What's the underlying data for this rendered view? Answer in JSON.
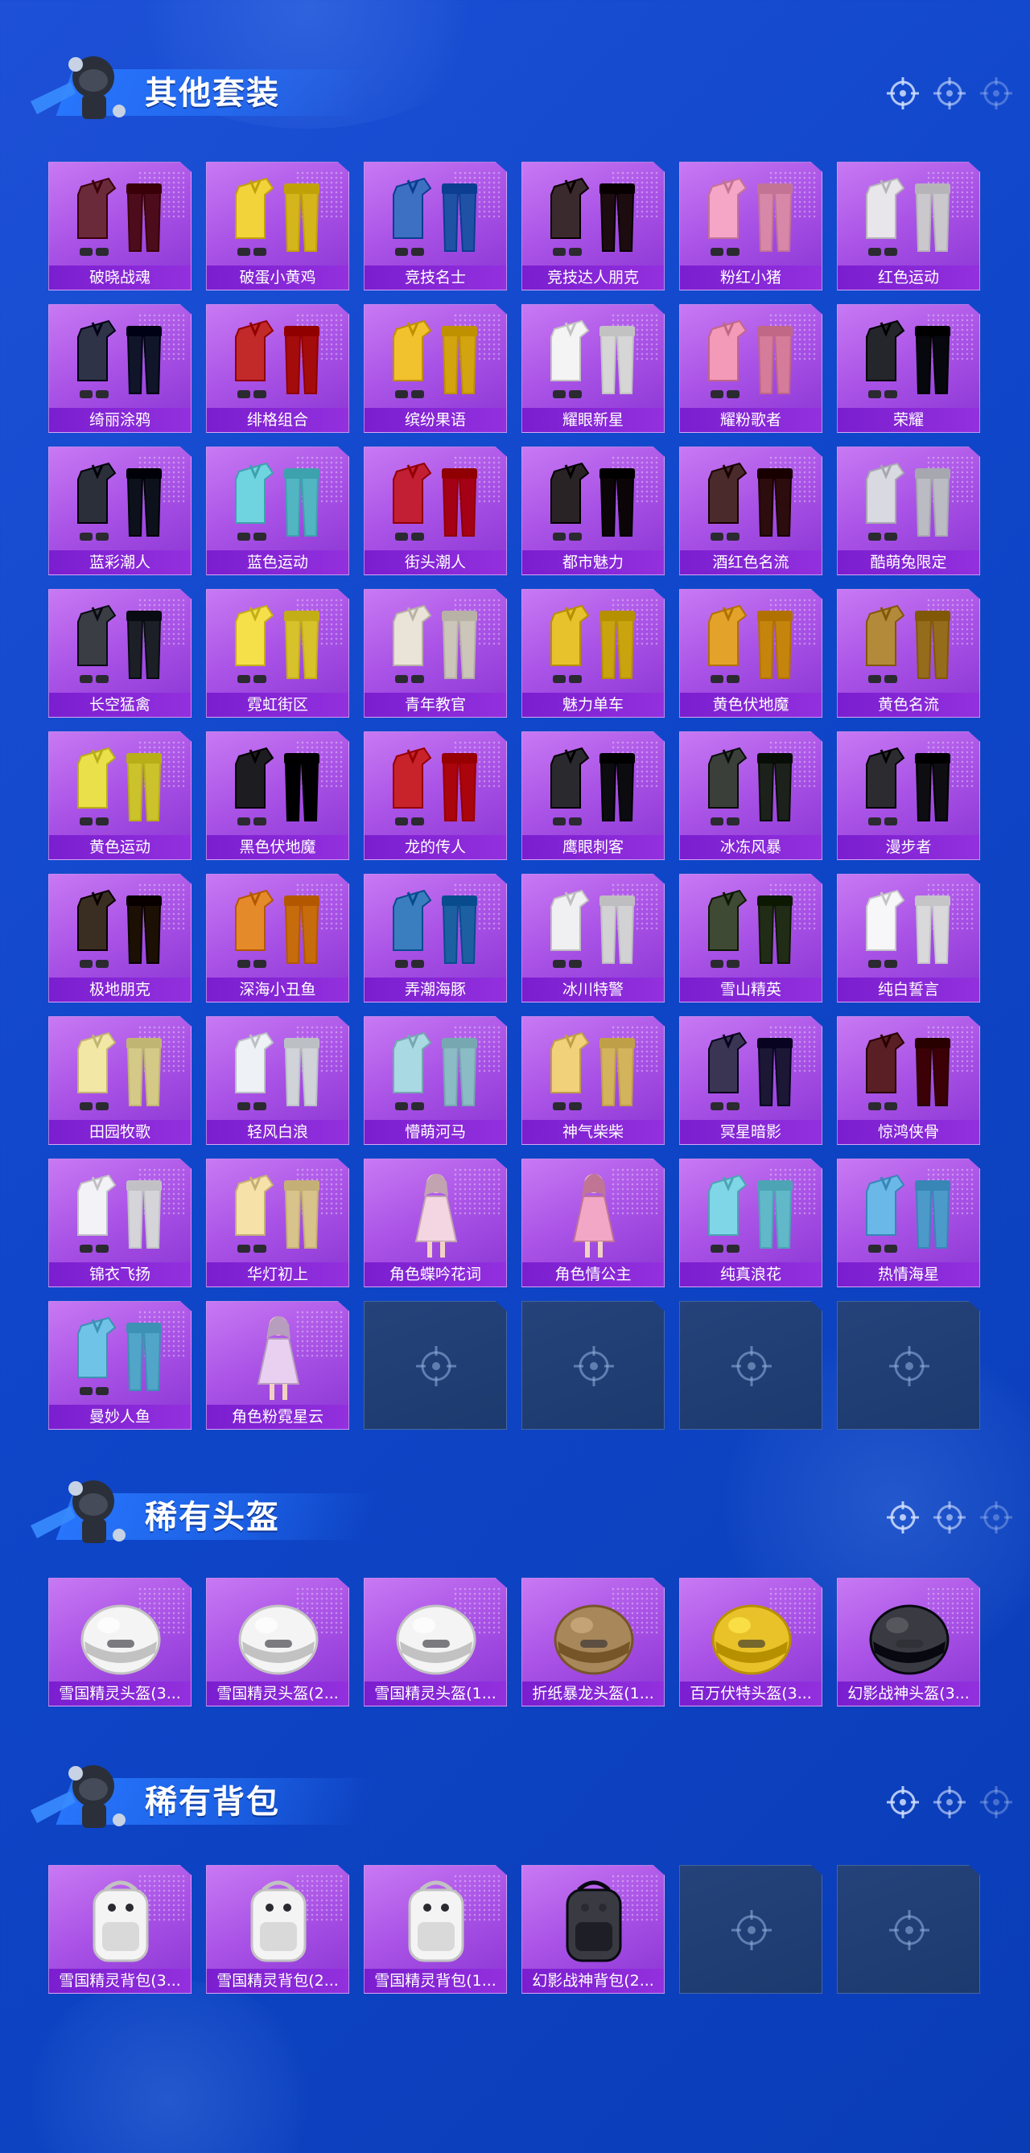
{
  "sections": [
    {
      "title": "其他套装",
      "items": [
        {
          "name": "破晓战魂",
          "icon": "outfit-icon",
          "color": "#6b2a3a"
        },
        {
          "name": "破蛋小黄鸡",
          "icon": "outfit-icon",
          "color": "#f2d43a"
        },
        {
          "name": "竞技名士",
          "icon": "outfit-icon",
          "color": "#3d6fc2"
        },
        {
          "name": "竞技达人朋克",
          "icon": "outfit-icon",
          "color": "#3a2a2e"
        },
        {
          "name": "粉红小猪",
          "icon": "outfit-icon",
          "color": "#f5a6c6"
        },
        {
          "name": "红色运动",
          "icon": "outfit-icon",
          "color": "#e8e6ea"
        },
        {
          "name": "绮丽涂鸦",
          "icon": "outfit-icon",
          "color": "#2e3347"
        },
        {
          "name": "绯格组合",
          "icon": "outfit-icon",
          "color": "#c22a2a"
        },
        {
          "name": "缤纷果语",
          "icon": "outfit-icon",
          "color": "#f1c22e"
        },
        {
          "name": "耀眼新星",
          "icon": "outfit-icon",
          "color": "#f4f4f4"
        },
        {
          "name": "耀粉歌者",
          "icon": "outfit-icon",
          "color": "#f29ab8"
        },
        {
          "name": "荣耀",
          "icon": "outfit-icon",
          "color": "#25262c"
        },
        {
          "name": "蓝彩潮人",
          "icon": "outfit-icon",
          "color": "#2b2f3a"
        },
        {
          "name": "蓝色运动",
          "icon": "outfit-icon",
          "color": "#6fd3e0"
        },
        {
          "name": "街头潮人",
          "icon": "outfit-icon",
          "color": "#c21f34"
        },
        {
          "name": "都市魅力",
          "icon": "outfit-icon",
          "color": "#2a2326"
        },
        {
          "name": "酒红色名流",
          "icon": "outfit-icon",
          "color": "#4a2a2a"
        },
        {
          "name": "酷萌兔限定",
          "icon": "outfit-icon",
          "color": "#d9d9e2"
        },
        {
          "name": "长空猛禽",
          "icon": "outfit-icon",
          "color": "#3a3d44"
        },
        {
          "name": "霓虹街区",
          "icon": "outfit-icon",
          "color": "#f5e04a"
        },
        {
          "name": "青年教官",
          "icon": "outfit-icon",
          "color": "#e9e3d8"
        },
        {
          "name": "魅力单车",
          "icon": "outfit-icon",
          "color": "#e7c22c"
        },
        {
          "name": "黄色伏地魔",
          "icon": "outfit-icon",
          "color": "#e3a32a"
        },
        {
          "name": "黄色名流",
          "icon": "outfit-icon",
          "color": "#b28a3a"
        },
        {
          "name": "黄色运动",
          "icon": "outfit-icon",
          "color": "#e9e04a"
        },
        {
          "name": "黑色伏地魔",
          "icon": "outfit-icon",
          "color": "#1d1d21"
        },
        {
          "name": "龙的传人",
          "icon": "outfit-icon",
          "color": "#c8232b"
        },
        {
          "name": "鹰眼刺客",
          "icon": "outfit-icon",
          "color": "#2a2a2e"
        },
        {
          "name": "冰冻风暴",
          "icon": "outfit-icon",
          "color": "#3a3f3a"
        },
        {
          "name": "漫步者",
          "icon": "outfit-icon",
          "color": "#2c2c30"
        },
        {
          "name": "极地朋克",
          "icon": "outfit-icon",
          "color": "#3a2e22"
        },
        {
          "name": "深海小丑鱼",
          "icon": "outfit-icon",
          "color": "#e58a2a"
        },
        {
          "name": "弄潮海豚",
          "icon": "outfit-icon",
          "color": "#3a7ec0"
        },
        {
          "name": "冰川特警",
          "icon": "outfit-icon",
          "color": "#f0f0f2"
        },
        {
          "name": "雪山精英",
          "icon": "outfit-icon",
          "color": "#3f4a34"
        },
        {
          "name": "纯白誓言",
          "icon": "outfit-icon",
          "color": "#f7f7fa"
        },
        {
          "name": "田园牧歌",
          "icon": "outfit-icon",
          "color": "#f3e7a6"
        },
        {
          "name": "轻风白浪",
          "icon": "outfit-icon",
          "color": "#eef2f7"
        },
        {
          "name": "懵萌河马",
          "icon": "outfit-icon",
          "color": "#a9d9e3"
        },
        {
          "name": "神气柴柴",
          "icon": "outfit-icon",
          "color": "#f1d27a"
        },
        {
          "name": "冥星暗影",
          "icon": "outfit-icon",
          "color": "#3a3552"
        },
        {
          "name": "惊鸿侠骨",
          "icon": "outfit-icon",
          "color": "#5a1f24"
        },
        {
          "name": "锦衣飞扬",
          "icon": "outfit-icon",
          "color": "#f3f3f7"
        },
        {
          "name": "华灯初上",
          "icon": "outfit-icon",
          "color": "#f6e2a8"
        },
        {
          "name": "角色蝶吟花词",
          "icon": "character-icon",
          "color": "#f3d6e2"
        },
        {
          "name": "角色情公主",
          "icon": "character-icon",
          "color": "#f2a7c6"
        },
        {
          "name": "纯真浪花",
          "icon": "outfit-icon",
          "color": "#7fd6e6"
        },
        {
          "name": "热情海星",
          "icon": "outfit-icon",
          "color": "#6ab8e8"
        },
        {
          "name": "曼妙人鱼",
          "icon": "outfit-icon",
          "color": "#6fc3e6"
        },
        {
          "name": "角色粉霓星云",
          "icon": "character-icon",
          "color": "#e9cff0"
        }
      ],
      "empty_slots": 4
    },
    {
      "title": "稀有头盔",
      "items": [
        {
          "name": "雪国精灵头盔(3...",
          "icon": "helmet-icon",
          "color": "#f4f4f4"
        },
        {
          "name": "雪国精灵头盔(2...",
          "icon": "helmet-icon",
          "color": "#f4f4f4"
        },
        {
          "name": "雪国精灵头盔(1...",
          "icon": "helmet-icon",
          "color": "#f4f4f4"
        },
        {
          "name": "折纸暴龙头盔(1...",
          "icon": "helmet-icon",
          "color": "#a8875a"
        },
        {
          "name": "百万伏特头盔(3...",
          "icon": "helmet-icon",
          "color": "#e9c22a"
        },
        {
          "name": "幻影战神头盔(3...",
          "icon": "helmet-icon",
          "color": "#3a3a42"
        }
      ],
      "empty_slots": 0
    },
    {
      "title": "稀有背包",
      "items": [
        {
          "name": "雪国精灵背包(3...",
          "icon": "backpack-icon",
          "color": "#f4f4f4"
        },
        {
          "name": "雪国精灵背包(2...",
          "icon": "backpack-icon",
          "color": "#f4f4f4"
        },
        {
          "name": "雪国精灵背包(1...",
          "icon": "backpack-icon",
          "color": "#f4f4f4"
        },
        {
          "name": "幻影战神背包(2...",
          "icon": "backpack-icon",
          "color": "#3a3a42"
        }
      ],
      "empty_slots": 2
    }
  ]
}
